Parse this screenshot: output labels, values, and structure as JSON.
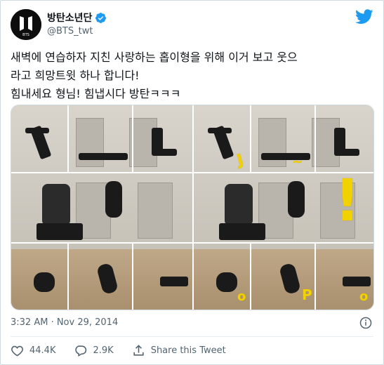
{
  "tweet": {
    "author_name": "방탄소년단",
    "author_handle": "@BTS_twt",
    "avatar_text": "BTS",
    "text": "새벽에 연습하자 지친 사랑하는 홉이형을 위해 이거 보고 웃으\n라고 희망트윗 하나 합니다!\n힘내세요 형님! 힘냅시다 방탄ㅋㅋㅋ",
    "timestamp": "3:32 AM · Nov 29, 2014"
  },
  "media": {
    "stickers": {
      "j": "J",
      "h": "~",
      "exclaim": "!",
      "o1": "o",
      "p": "P",
      "o2": "o"
    }
  },
  "actions": {
    "likes": "44.4K",
    "replies": "2.9K",
    "share_label": "Share this Tweet"
  },
  "colors": {
    "brand_blue": "#1d9bf0",
    "text_secondary": "#536471",
    "sticker_yellow": "#f2d100"
  },
  "icons": {
    "verified": "verified-badge-icon",
    "logo": "twitter-bird-icon",
    "info": "info-icon",
    "like": "heart-icon",
    "reply": "reply-bubble-icon",
    "share": "share-upload-icon"
  }
}
